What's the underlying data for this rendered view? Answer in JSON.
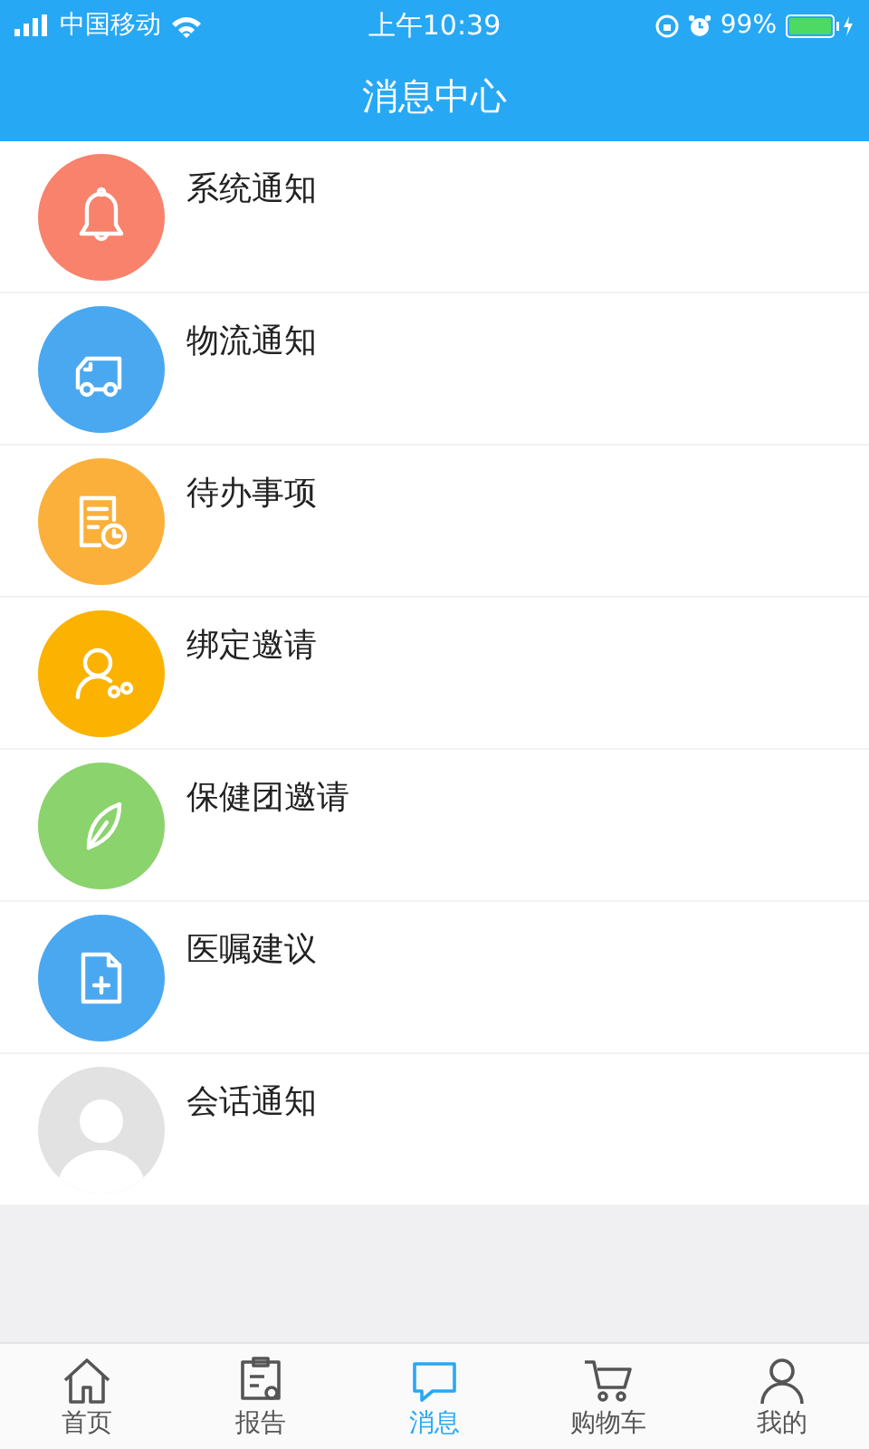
{
  "status_bar": {
    "carrier": "中国移动",
    "time": "上午10:39",
    "battery": "99%"
  },
  "header": {
    "title": "消息中心"
  },
  "messages": [
    {
      "title": "系统通知",
      "kind": "icon",
      "color": "#f8826b"
    },
    {
      "title": "物流通知",
      "kind": "icon",
      "color": "#4aa8f0"
    },
    {
      "title": "待办事项",
      "kind": "icon",
      "color": "#fbb03b"
    },
    {
      "title": "绑定邀请",
      "kind": "icon",
      "color": "#fbb200"
    },
    {
      "title": "保健团邀请",
      "kind": "icon",
      "color": "#8bd36d"
    },
    {
      "title": "医嘱建议",
      "kind": "icon",
      "color": "#4aa8f0"
    },
    {
      "title": "会话通知",
      "kind": "avatar",
      "color": "#e2e2e2"
    }
  ],
  "tabs": [
    {
      "label": "首页",
      "selected": false
    },
    {
      "label": "报告",
      "selected": false
    },
    {
      "label": "消息",
      "selected": true
    },
    {
      "label": "购物车",
      "selected": false
    },
    {
      "label": "我的",
      "selected": false
    }
  ]
}
